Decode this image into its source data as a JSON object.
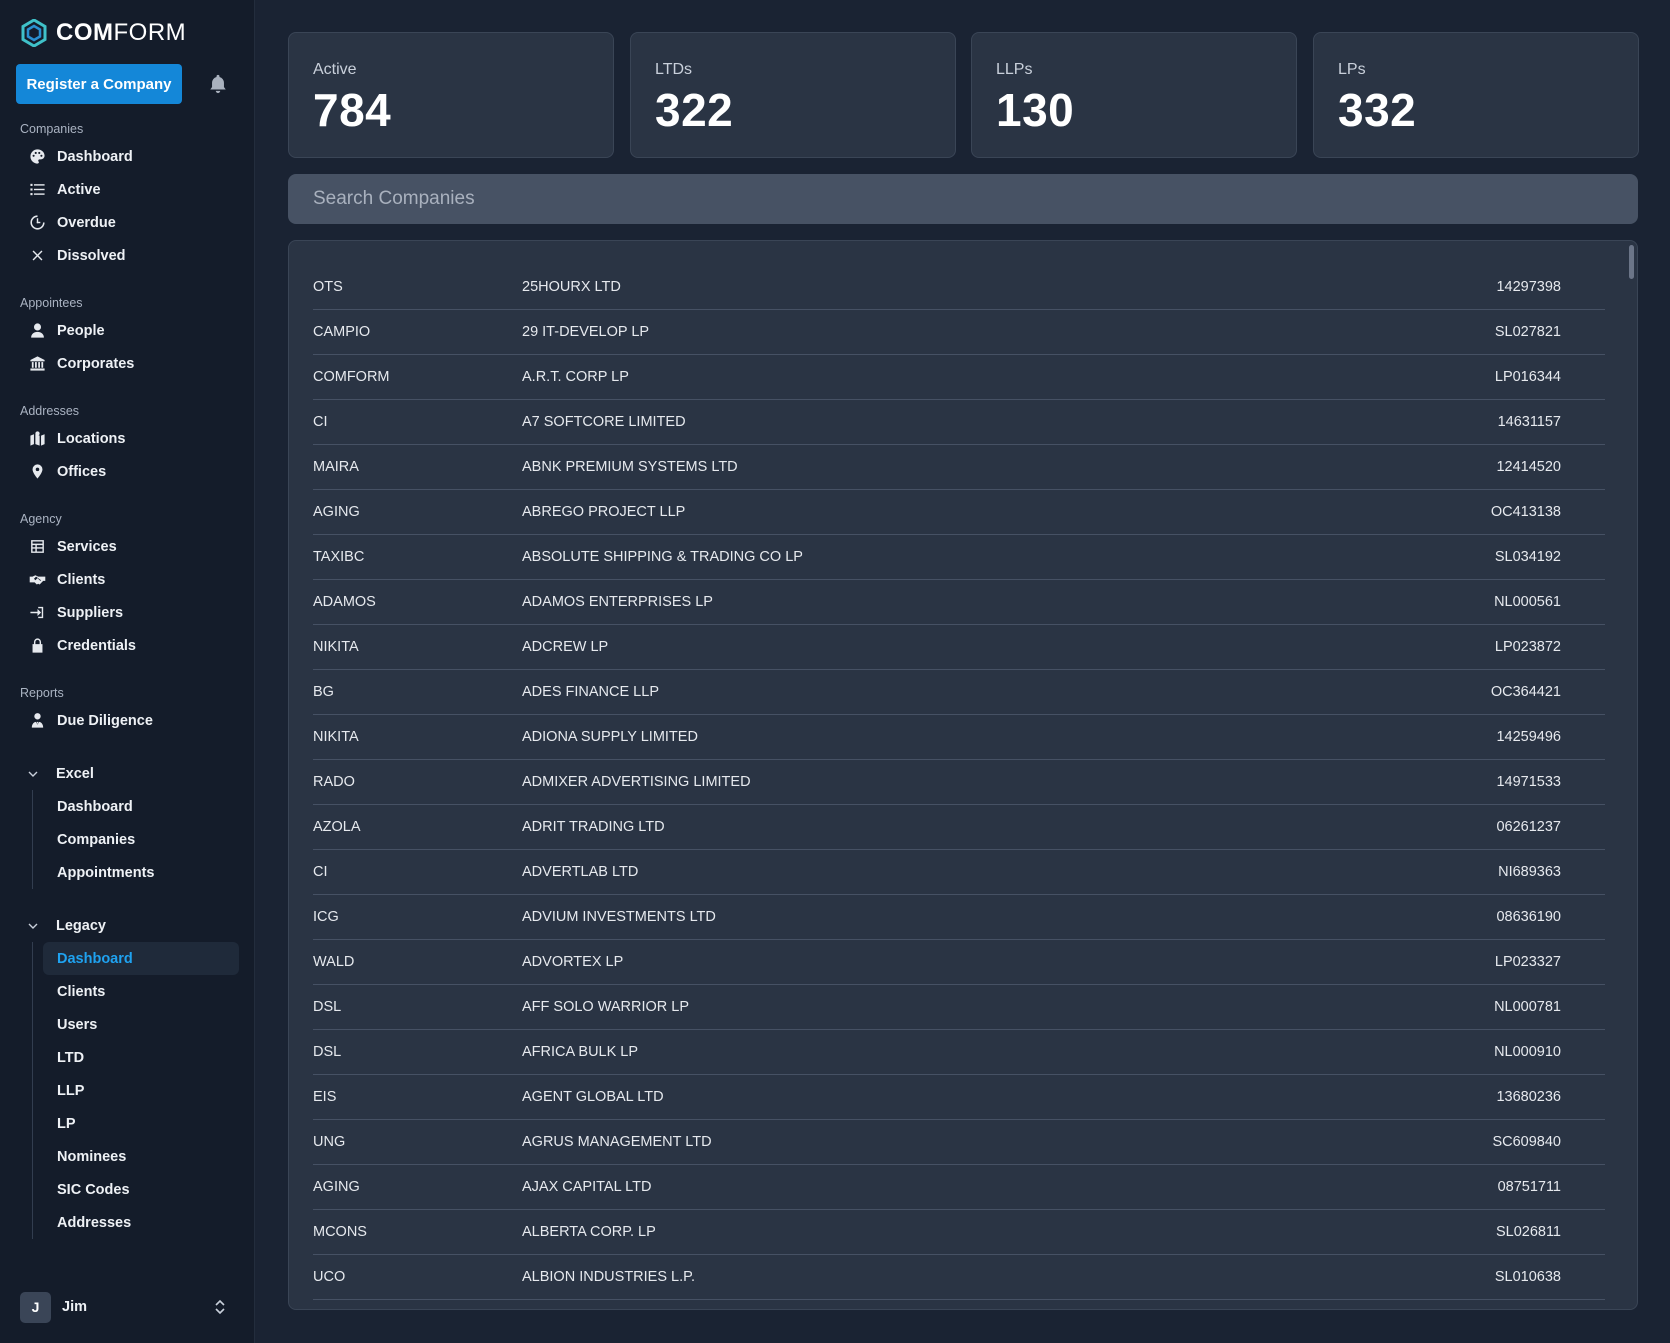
{
  "app": {
    "logo_bold": "COM",
    "logo_light": "FORM",
    "register_label": "Register a Company"
  },
  "sidebar": {
    "sections": [
      {
        "label": "Companies",
        "items": [
          {
            "label": "Dashboard",
            "icon": "palette-icon"
          },
          {
            "label": "Active",
            "icon": "list-icon"
          },
          {
            "label": "Overdue",
            "icon": "clock-icon"
          },
          {
            "label": "Dissolved",
            "icon": "x-icon"
          }
        ]
      },
      {
        "label": "Appointees",
        "items": [
          {
            "label": "People",
            "icon": "person-icon"
          },
          {
            "label": "Corporates",
            "icon": "bank-icon"
          }
        ]
      },
      {
        "label": "Addresses",
        "items": [
          {
            "label": "Locations",
            "icon": "map-icon"
          },
          {
            "label": "Offices",
            "icon": "pin-icon"
          }
        ]
      },
      {
        "label": "Agency",
        "items": [
          {
            "label": "Services",
            "icon": "table-icon"
          },
          {
            "label": "Clients",
            "icon": "handshake-icon"
          },
          {
            "label": "Suppliers",
            "icon": "sign-in-icon"
          },
          {
            "label": "Credentials",
            "icon": "lock-icon"
          }
        ]
      },
      {
        "label": "Reports",
        "items": [
          {
            "label": "Due Diligence",
            "icon": "user-tie-icon"
          }
        ]
      }
    ],
    "excel": {
      "label": "Excel",
      "items": [
        "Dashboard",
        "Companies",
        "Appointments"
      ]
    },
    "legacy": {
      "label": "Legacy",
      "items": [
        "Dashboard",
        "Clients",
        "Users",
        "LTD",
        "LLP",
        "LP",
        "Nominees",
        "SIC Codes",
        "Addresses"
      ],
      "active": "Dashboard"
    },
    "user": {
      "initial": "J",
      "name": "Jim"
    }
  },
  "stats": [
    {
      "label": "Active",
      "value": "784"
    },
    {
      "label": "LTDs",
      "value": "322"
    },
    {
      "label": "LLPs",
      "value": "130"
    },
    {
      "label": "LPs",
      "value": "332"
    }
  ],
  "search": {
    "placeholder": "Search Companies"
  },
  "companies": [
    [
      "OTS",
      "25HOURX LTD",
      "14297398"
    ],
    [
      "CAMPIO",
      "29 IT-DEVELOP LP",
      "SL027821"
    ],
    [
      "COMFORM",
      "A.R.T. CORP LP",
      "LP016344"
    ],
    [
      "CI",
      "A7 SOFTCORE LIMITED",
      "14631157"
    ],
    [
      "MAIRA",
      "ABNK PREMIUM SYSTEMS LTD",
      "12414520"
    ],
    [
      "AGING",
      "ABREGO PROJECT LLP",
      "OC413138"
    ],
    [
      "TAXIBC",
      "ABSOLUTE SHIPPING & TRADING CO LP",
      "SL034192"
    ],
    [
      "ADAMOS",
      "ADAMOS ENTERPRISES LP",
      "NL000561"
    ],
    [
      "NIKITA",
      "ADCREW LP",
      "LP023872"
    ],
    [
      "BG",
      "ADES FINANCE LLP",
      "OC364421"
    ],
    [
      "NIKITA",
      "ADIONA SUPPLY LIMITED",
      "14259496"
    ],
    [
      "RADO",
      "ADMIXER ADVERTISING LIMITED",
      "14971533"
    ],
    [
      "AZOLA",
      "ADRIT TRADING LTD",
      "06261237"
    ],
    [
      "CI",
      "ADVERTLAB LTD",
      "NI689363"
    ],
    [
      "ICG",
      "ADVIUM INVESTMENTS LTD",
      "08636190"
    ],
    [
      "WALD",
      "ADVORTEX LP",
      "LP023327"
    ],
    [
      "DSL",
      "AFF SOLO WARRIOR LP",
      "NL000781"
    ],
    [
      "DSL",
      "AFRICA BULK LP",
      "NL000910"
    ],
    [
      "EIS",
      "AGENT GLOBAL LTD",
      "13680236"
    ],
    [
      "UNG",
      "AGRUS MANAGEMENT LTD",
      "SC609840"
    ],
    [
      "AGING",
      "AJAX CAPITAL LTD",
      "08751711"
    ],
    [
      "MCONS",
      "ALBERTA CORP. LP",
      "SL026811"
    ],
    [
      "UCO",
      "ALBION INDUSTRIES L.P.",
      "SL010638"
    ]
  ]
}
